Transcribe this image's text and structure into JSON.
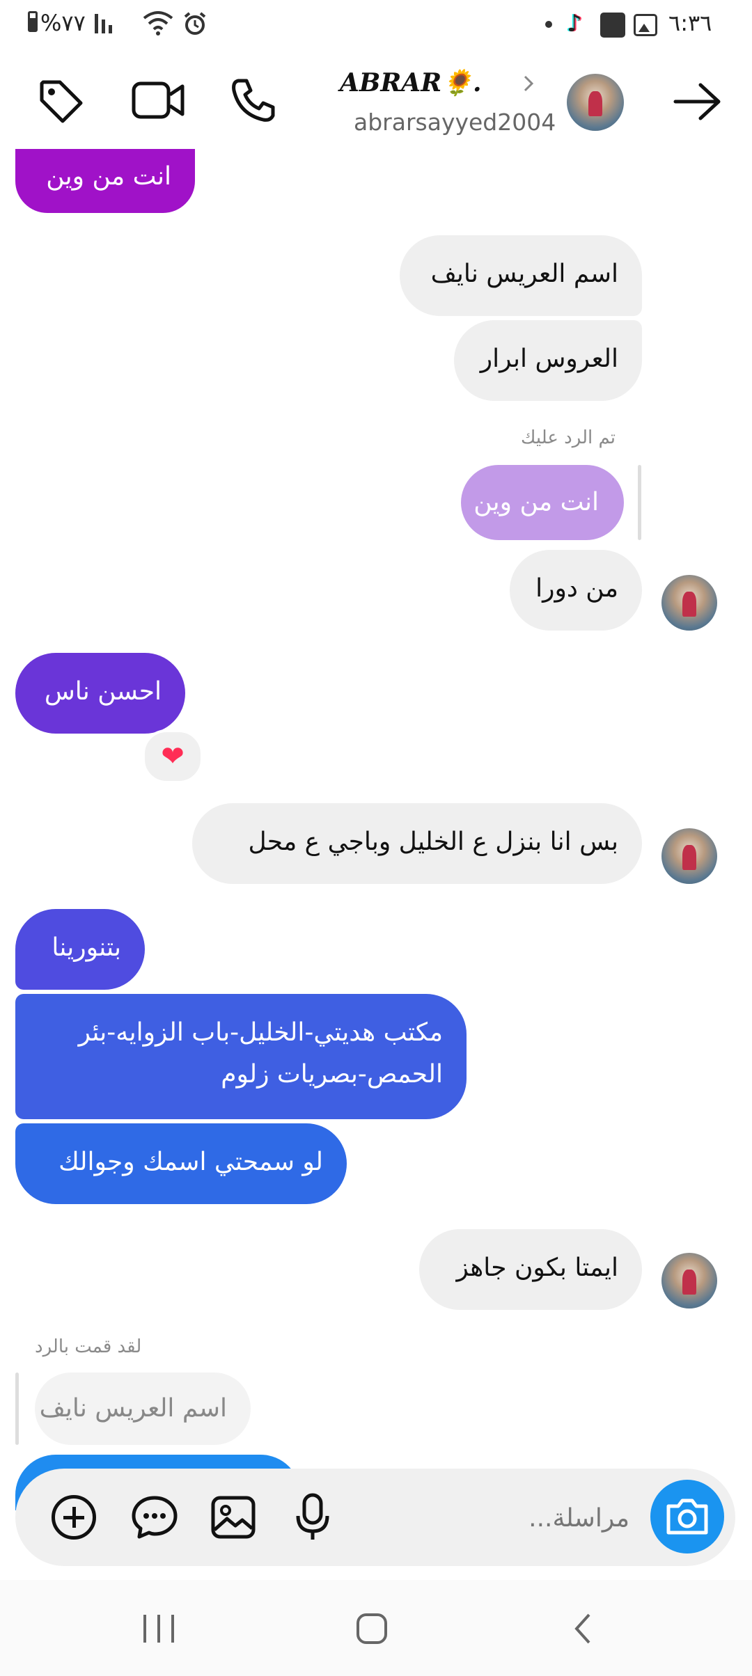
{
  "status_bar": {
    "time": "٦:٣٦",
    "battery": "%٧٧"
  },
  "header": {
    "display_name": "ABRAR🌻.",
    "username": "abrarsayyed2004"
  },
  "messages": {
    "m1": "انت من وين",
    "m2": "اسم العريس نايف",
    "m3": "العروس ابرار",
    "reply_label_1": "تم الرد عليك",
    "m4_quoted": "انت من وين",
    "m5": "من دورا",
    "m6": "احسن ناس",
    "reaction": "❤",
    "m7": "بس انا بنزل ع الخليل وباجي ع محل",
    "m8": "بتنورينا",
    "m9_line1": "مكتب هديتي-الخليل-باب الزوايه-بئر",
    "m9_line2": "الحمص-بصريات زلوم",
    "m10": "لو سمحتي اسمك وجوالك",
    "m11": "ايمتا بكون جاهز",
    "reply_label_2": "لقد قمت بالرد",
    "m12_quoted": "اسم العريس نايف"
  },
  "composer": {
    "placeholder": "مراسلة..."
  },
  "colors": {
    "purple": "#a012c8",
    "violet": "#6a35d8",
    "indigo": "#4f4ce0",
    "blue": "#3a68e4",
    "blue2": "#2b72e8",
    "quoted_lilac": "#c29ae8",
    "camera_blue": "#1a94f0"
  }
}
